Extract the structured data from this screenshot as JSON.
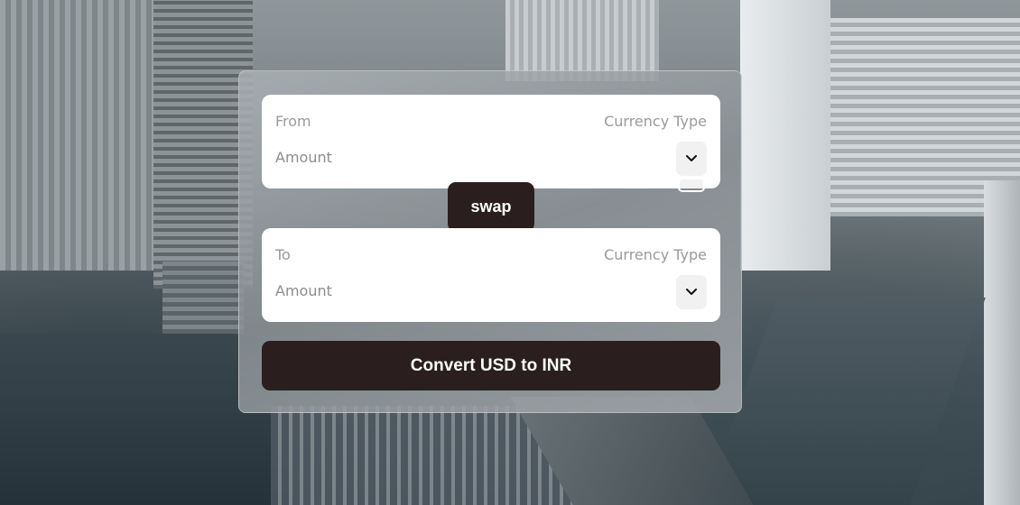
{
  "from": {
    "label": "From",
    "currency_type_label": "Currency Type",
    "amount_placeholder": "Amount",
    "amount_value": "",
    "currency_selected": ""
  },
  "swap_label": "swap",
  "to": {
    "label": "To",
    "currency_type_label": "Currency Type",
    "amount_placeholder": "Amount",
    "amount_value": "",
    "currency_selected": ""
  },
  "convert_label": "Convert USD to INR",
  "icons": {
    "dropdown": "chevron-down-icon"
  },
  "colors": {
    "button_bg": "#2a1f1e",
    "button_text": "#ffffff",
    "field_bg": "#ffffff"
  }
}
